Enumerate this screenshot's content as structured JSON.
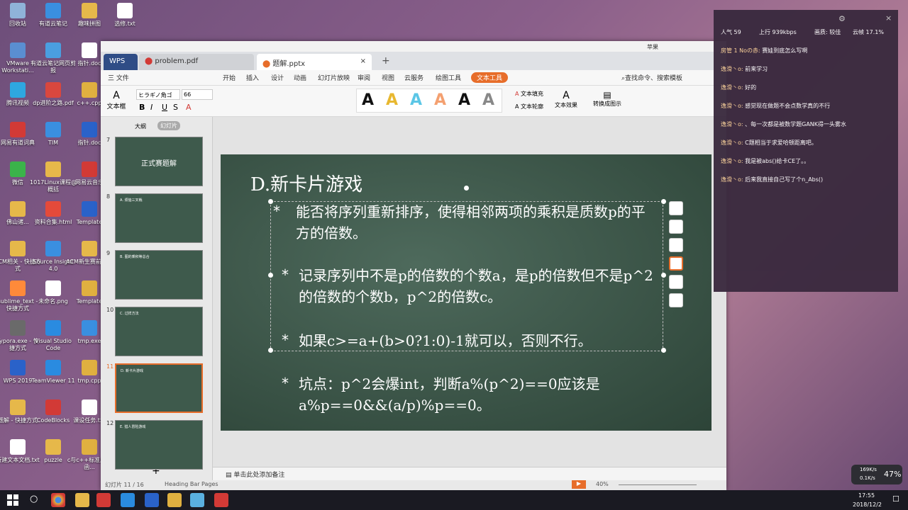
{
  "desktop": {
    "icons": [
      {
        "label": "回收站",
        "color": "#8fb3d9"
      },
      {
        "label": "有道云笔记",
        "color": "#3a8fe0"
      },
      {
        "label": "趣味拼图",
        "color": "#e6b84a"
      },
      {
        "label": "选修.txt",
        "color": "#ffffff"
      },
      {
        "label": "VMware Workstati...",
        "color": "#5a8ed1"
      },
      {
        "label": "有道云笔记网页剪报",
        "color": "#4a9ee0"
      },
      {
        "label": "指针.doc",
        "color": "#ffffff"
      },
      {
        "label": "腾讯视频",
        "color": "#2ea7e0"
      },
      {
        "label": "dp进阶之路.pdf",
        "color": "#d9473e"
      },
      {
        "label": "c++.cpp",
        "color": "#e0b040"
      },
      {
        "label": "网易有道词典",
        "color": "#d23a36"
      },
      {
        "label": "TIM",
        "color": "#3a8fe0"
      },
      {
        "label": "指针.doc",
        "color": "#2a62c9"
      },
      {
        "label": "微信",
        "color": "#3bb34a"
      },
      {
        "label": "1017Linux课程@概括",
        "color": "#e6b84a"
      },
      {
        "label": "网易云音乐",
        "color": "#d23a36"
      },
      {
        "label": "佛山诸...",
        "color": "#e6b84a"
      },
      {
        "label": "资料合集.html",
        "color": "#e44a3a"
      },
      {
        "label": "Template",
        "color": "#2a62c9"
      },
      {
        "label": "ACM相关 - 快捷方式",
        "color": "#e6b84a"
      },
      {
        "label": "Source Insight 4.0",
        "color": "#3a8fe0"
      },
      {
        "label": "ACM新生赛前必看",
        "color": "#e6b84a"
      },
      {
        "label": "sublime_text - 快捷方式",
        "color": "#ff8a3a"
      },
      {
        "label": "未命名.png",
        "color": "#ffffff"
      },
      {
        "label": "Template",
        "color": "#e0b040"
      },
      {
        "label": "Typora.exe - 快捷方式",
        "color": "#6a6a6a"
      },
      {
        "label": "Visual Studio Code",
        "color": "#2a8be0"
      },
      {
        "label": "tmp.exe",
        "color": "#3a8fe0"
      },
      {
        "label": "WPS 2019",
        "color": "#2a62c9"
      },
      {
        "label": "TeamViewer 11",
        "color": "#2a8be0"
      },
      {
        "label": "tmp.cpp",
        "color": "#e0b040"
      },
      {
        "label": "题解 - 快捷方式",
        "color": "#e6b84a"
      },
      {
        "label": "CodeBlocks",
        "color": "#d23a36"
      },
      {
        "label": "课设任务.txt",
        "color": "#ffffff"
      },
      {
        "label": "新建文本文档.txt",
        "color": "#ffffff"
      },
      {
        "label": "puzzle",
        "color": "#e6b84a"
      },
      {
        "label": "c与c++标准库及函...",
        "color": "#e0b040"
      }
    ]
  },
  "wps": {
    "window_user": "苹果",
    "tabs": [
      "WPS",
      "problem.pdf",
      "题解.pptx"
    ],
    "menu": [
      "三 文件",
      "开始",
      "插入",
      "设计",
      "动画",
      "幻灯片放映",
      "审阅",
      "视图",
      "云服务",
      "绘图工具",
      "文本工具"
    ],
    "search": "查找命令、搜索模板",
    "font_name": "ヒラギノ角ゴ",
    "font_size": "66",
    "ribbon_labels": {
      "textbox": "文本框",
      "fill": "文本填充",
      "outline": "文本轮廓",
      "effect": "文本效果",
      "convert": "转换成图示"
    },
    "sidebar_tabs": [
      "大纲",
      "幻灯片"
    ],
    "thumbs": [
      {
        "num": "7",
        "title": "正式赛题解"
      },
      {
        "num": "8",
        "title": "A. 烦恼三叉戟"
      },
      {
        "num": "9",
        "title": "B. 图的乘积等总合"
      },
      {
        "num": "10",
        "title": "C. 过样方法"
      },
      {
        "num": "11",
        "title": "D. 新卡片游戏"
      },
      {
        "num": "12",
        "title": "E. 猎人冒险游戏"
      }
    ],
    "notes_placeholder": "单击此处添加备注",
    "status": {
      "slide": "幻灯片 11 / 16",
      "theme": "Heading Bar Pages",
      "zoom": "40%"
    }
  },
  "slide": {
    "title": "D.新卡片游戏",
    "bullets": [
      {
        "star": "*",
        "text": "能否将序列重新排序，使得相邻两项的乘积是质数p的平方的倍数。"
      },
      {
        "star": "*",
        "text": "记录序列中不是p的倍数的个数a，是p的倍数但不是p^2的倍数的个数b，p^2的倍数c。"
      },
      {
        "star": "*",
        "text": "如果c>=a+(b>0?1:0)-1就可以，否则不行。"
      },
      {
        "star": "*",
        "text": "坑点：p^2会爆int，判断a%(p^2)==0应该是a%p==0&&(a/p)%p==0。"
      }
    ]
  },
  "chat": {
    "header": {
      "popularity": "人气  59",
      "upload": "上行  939kbps",
      "q1": "画质: 较佳",
      "q2": "云帧 17.1%"
    },
    "messages": [
      {
        "user": "房管 1 Noの赤:",
        "text": "赛娃到底怎么写啊"
      },
      {
        "user": "逸滑丶o:",
        "text": "前来学习"
      },
      {
        "user": "逸滑丶o:",
        "text": "好的"
      },
      {
        "user": "逸滑丶o:",
        "text": "感觉现在做题不会点数学真的不行"
      },
      {
        "user": "逸滑丶o:",
        "text": "、每一次都是被数学题GANK得一头雾水"
      },
      {
        "user": "逸滑丶o:",
        "text": "C题相当于求爱哈顿距离吧。"
      },
      {
        "user": "逸滑丶o:",
        "text": "我是被abs()给卡CE了。。"
      },
      {
        "user": "逸滑丶o:",
        "text": "后来我直接自己写了个n_Abs()"
      }
    ]
  },
  "tray": {
    "net_up": "169K/s",
    "net_down": "0.1K/s",
    "cpu": "47%",
    "time": "17:55",
    "date": "2018/12/2"
  }
}
